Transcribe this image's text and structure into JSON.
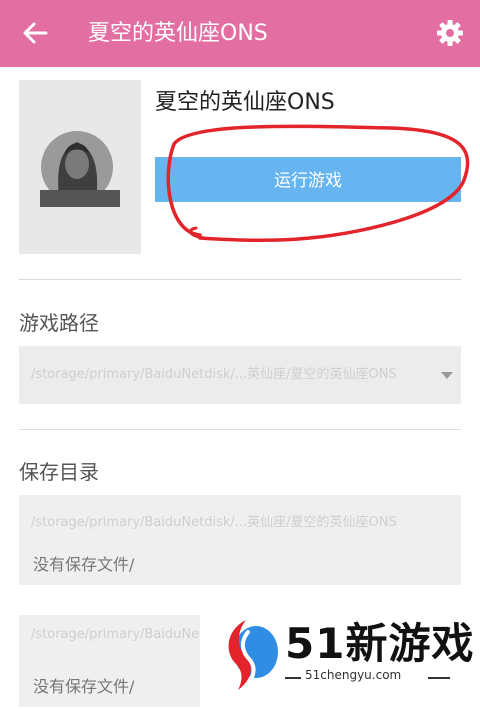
{
  "appbar": {
    "title": "夏空的英仙座ONS",
    "back_icon": "arrow-left-icon",
    "settings_icon": "gear-icon",
    "color": "#e36fa2"
  },
  "game": {
    "name": "夏空的英仙座ONS",
    "run_label": "运行游戏",
    "run_color": "#66b4f0"
  },
  "game_path": {
    "label": "游戏路径",
    "value": "/storage/primary/BaiduNetdisk/...英仙座/夏空的英仙座ONS"
  },
  "save_dir": {
    "label": "保存目录",
    "path": "/storage/primary/BaiduNetdisk/...英仙座/夏空的英仙座ONS",
    "empty_text": "没有保存文件/"
  },
  "second_save": {
    "path": "/storage/primary/BaiduNetdisk/",
    "empty_text": "没有保存文件/"
  },
  "watermark": {
    "brand": "51新游戏",
    "url": "51chengyu.com"
  }
}
